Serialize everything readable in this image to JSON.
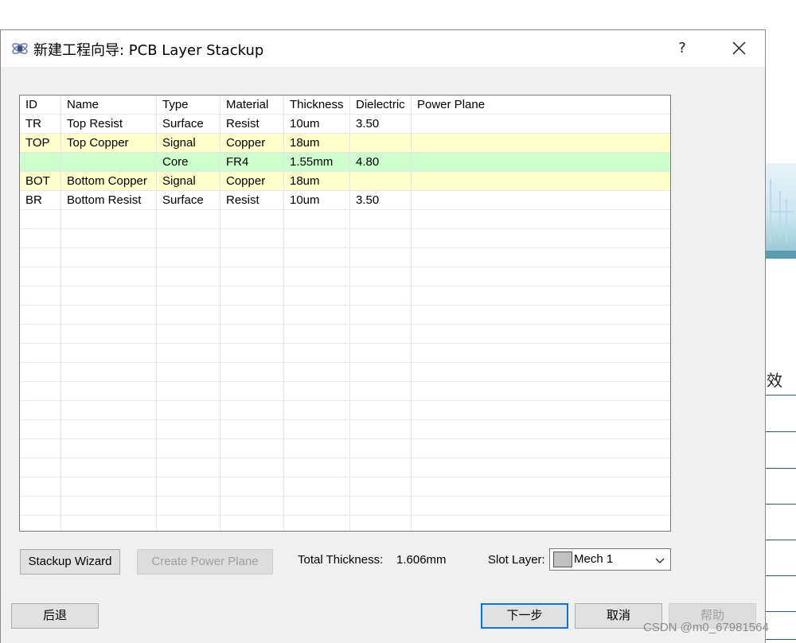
{
  "background": {
    "partial_text": "效",
    "watermark": "CSDN @m0_67981564"
  },
  "dialog": {
    "title": "新建工程向导: PCB Layer Stackup",
    "help_glyph": "?",
    "icons": {
      "title": "app-icon",
      "close": "close-icon",
      "dropdown": "chevron-down-icon"
    }
  },
  "grid": {
    "columns": [
      "ID",
      "Name",
      "Type",
      "Material",
      "Thickness",
      "Dielectric",
      "Power Plane"
    ],
    "rows": [
      {
        "id": "TR",
        "name": "Top Resist",
        "type": "Surface",
        "material": "Resist",
        "thickness": "10um",
        "dielectric": "3.50",
        "power_plane": "",
        "color": "#ffffff"
      },
      {
        "id": "TOP",
        "name": "Top Copper",
        "type": "Signal",
        "material": "Copper",
        "thickness": "18um",
        "dielectric": "",
        "power_plane": "",
        "color": "#ffffcc"
      },
      {
        "id": "",
        "name": "",
        "type": "Core",
        "material": "FR4",
        "thickness": "1.55mm",
        "dielectric": "4.80",
        "power_plane": "",
        "color": "#ccffcc"
      },
      {
        "id": "BOT",
        "name": "Bottom Copper",
        "type": "Signal",
        "material": "Copper",
        "thickness": "18um",
        "dielectric": "",
        "power_plane": "",
        "color": "#ffffcc"
      },
      {
        "id": "BR",
        "name": "Bottom Resist",
        "type": "Surface",
        "material": "Resist",
        "thickness": "10um",
        "dielectric": "3.50",
        "power_plane": "",
        "color": "#ffffff"
      }
    ]
  },
  "controls": {
    "stackup_wizard": "Stackup Wizard",
    "create_power_plane": "Create Power Plane",
    "total_thickness_label": "Total Thickness:",
    "total_thickness_value": "1.606mm",
    "slot_layer_label": "Slot Layer:",
    "slot_layer_value": "Mech 1",
    "slot_layer_swatch": "#c0c0c0"
  },
  "footer": {
    "back": "后退",
    "next": "下一步",
    "cancel": "取消",
    "help": "帮助"
  }
}
